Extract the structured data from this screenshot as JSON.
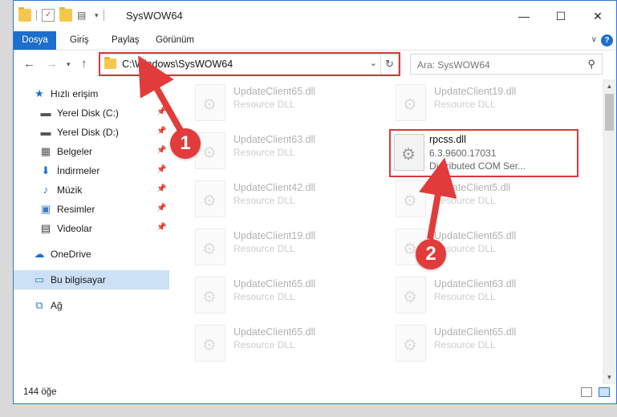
{
  "window": {
    "title": "SysWOW64"
  },
  "controls": {
    "minimize": "—",
    "maximize": "☐",
    "close": "✕"
  },
  "ribbon": {
    "tabs": [
      {
        "label": "Dosya"
      },
      {
        "label": "Giriş"
      },
      {
        "label": "Paylaş"
      },
      {
        "label": "Görünüm"
      }
    ],
    "help": "?"
  },
  "address": {
    "path": "C:\\Windows\\SysWOW64"
  },
  "search": {
    "placeholder": "Ara: SysWOW64"
  },
  "sidebar": {
    "items": [
      {
        "label": "Hızlı erişim"
      },
      {
        "label": "Yerel Disk (C:)"
      },
      {
        "label": "Yerel Disk (D:)"
      },
      {
        "label": "Belgeler"
      },
      {
        "label": "İndirmeler"
      },
      {
        "label": "Müzik"
      },
      {
        "label": "Resimler"
      },
      {
        "label": "Videolar"
      },
      {
        "label": "OneDrive"
      },
      {
        "label": "Bu bilgisayar"
      },
      {
        "label": "Ağ"
      }
    ]
  },
  "files": [
    {
      "name": "UpdateClient65.dll",
      "line1": "Resource DLL",
      "line2": ""
    },
    {
      "name": "UpdateClient19.dll",
      "line1": "Resource DLL",
      "line2": ""
    },
    {
      "name": "UpdateClient63.dll",
      "line1": "Resource DLL",
      "line2": ""
    },
    {
      "name": "rpcss.dll",
      "line1": "6.3.9600.17031",
      "line2": "Distributed COM Ser..."
    },
    {
      "name": "UpdateClient42.dll",
      "line1": "Resource DLL",
      "line2": ""
    },
    {
      "name": "UpdateClient5.dll",
      "line1": "Resource DLL",
      "line2": ""
    },
    {
      "name": "UpdateClient19.dll",
      "line1": "Resource DLL",
      "line2": ""
    },
    {
      "name": "UpdateClient65.dll",
      "line1": "Resource DLL",
      "line2": ""
    },
    {
      "name": "UpdateClient65.dll",
      "line1": "Resource DLL",
      "line2": ""
    },
    {
      "name": "UpdateClient63.dll",
      "line1": "Resource DLL",
      "line2": ""
    },
    {
      "name": "UpdateClient65.dll",
      "line1": "Resource DLL",
      "line2": ""
    },
    {
      "name": "UpdateClient65.dll",
      "line1": "Resource DLL",
      "line2": ""
    }
  ],
  "status": {
    "count": "144 öğe"
  },
  "callouts": {
    "one": "1",
    "two": "2"
  },
  "colors": {
    "accent": "#1e6ecb",
    "highlight": "#d9383a",
    "selected": "#cce1f5"
  }
}
